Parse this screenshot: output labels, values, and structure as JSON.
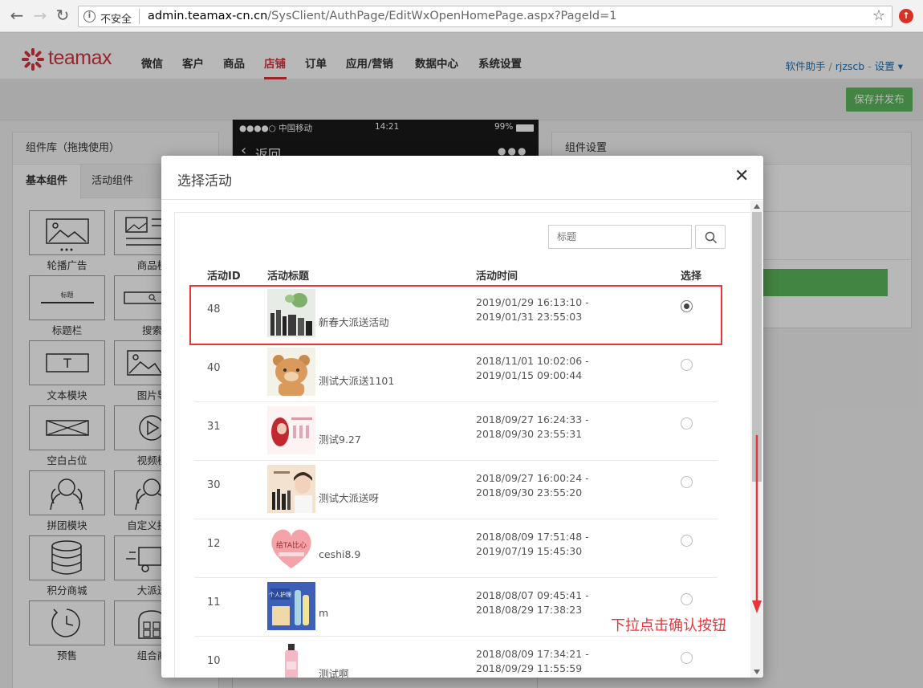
{
  "browser": {
    "insecure_label": "不安全",
    "url_host": "admin.teamax-cn.cn",
    "url_path": "/SysClient/AuthPage/EditWxOpenHomePage.aspx?PageId=1"
  },
  "header": {
    "brand": "teamax",
    "nav": [
      "微信",
      "客户",
      "商品",
      "店铺",
      "订单",
      "应用/营销",
      "数据中心",
      "系统设置"
    ],
    "active_nav": "店铺",
    "user_helper": "软件助手",
    "user_sep": "/",
    "user_name": "rjzscb",
    "user_dash": "-",
    "settings": "设置"
  },
  "toolbar": {
    "publish_label": "保存并发布"
  },
  "left_panel": {
    "title": "组件库（拖拽使用）",
    "tabs": [
      "基本组件",
      "活动组件"
    ],
    "components": [
      "轮播广告",
      "商品模",
      "标题栏",
      "搜索",
      "文本模块",
      "图片导",
      "空白占位",
      "视频模",
      "拼团模块",
      "自定义拼团",
      "积分商城",
      "大派送",
      "预售",
      "组合商"
    ],
    "title_icon_text": "标题"
  },
  "phone": {
    "carrier": "●●●●○ 中国移动",
    "time": "14:21",
    "battery": "99%",
    "back_label": "返回",
    "more": "●●●"
  },
  "right_panel": {
    "title": "组件设置"
  },
  "modal": {
    "title": "选择活动",
    "search_placeholder": "标题",
    "columns": [
      "活动ID",
      "活动标题",
      "活动时间",
      "选择"
    ],
    "rows": [
      {
        "id": "48",
        "title": "新春大派送活动",
        "time_start": "2019/01/29 16:13:10 -",
        "time_end": "2019/01/31 23:55:03",
        "selected": true,
        "thumb": "cosmetics"
      },
      {
        "id": "40",
        "title": "测试大派送1101",
        "time_start": "2018/11/01 10:02:06 -",
        "time_end": "2019/01/15 09:00:44",
        "selected": false,
        "thumb": "bear"
      },
      {
        "id": "31",
        "title": "测试9.27",
        "time_start": "2018/09/27 16:24:33 -",
        "time_end": "2018/09/30 23:55:31",
        "selected": false,
        "thumb": "girl"
      },
      {
        "id": "30",
        "title": "测试大派送呀",
        "time_start": "2018/09/27 16:00:24 -",
        "time_end": "2018/09/30 23:55:20",
        "selected": false,
        "thumb": "man"
      },
      {
        "id": "12",
        "title": "ceshi8.9",
        "time_start": "2018/08/09 17:51:48 -",
        "time_end": "2019/07/19 15:45:30",
        "selected": false,
        "thumb": "heart"
      },
      {
        "id": "11",
        "title": "m",
        "time_start": "2018/08/07 09:45:41 -",
        "time_end": "2018/08/29 17:38:23",
        "selected": false,
        "thumb": "blue"
      },
      {
        "id": "10",
        "title": "测试啊",
        "time_start": "2018/08/09 17:34:21 -",
        "time_end": "2018/09/29 11:55:59",
        "selected": false,
        "thumb": "bottle"
      }
    ]
  },
  "annotation": {
    "text": "下拉点击确认按钮"
  },
  "thumb_texts": {
    "heart": "给TA比心",
    "blue": "个人护理"
  },
  "colors": {
    "brand_red": "#d4343f",
    "green": "#5cb85c",
    "highlight": "#e8353a",
    "link": "#1f6fb2"
  }
}
